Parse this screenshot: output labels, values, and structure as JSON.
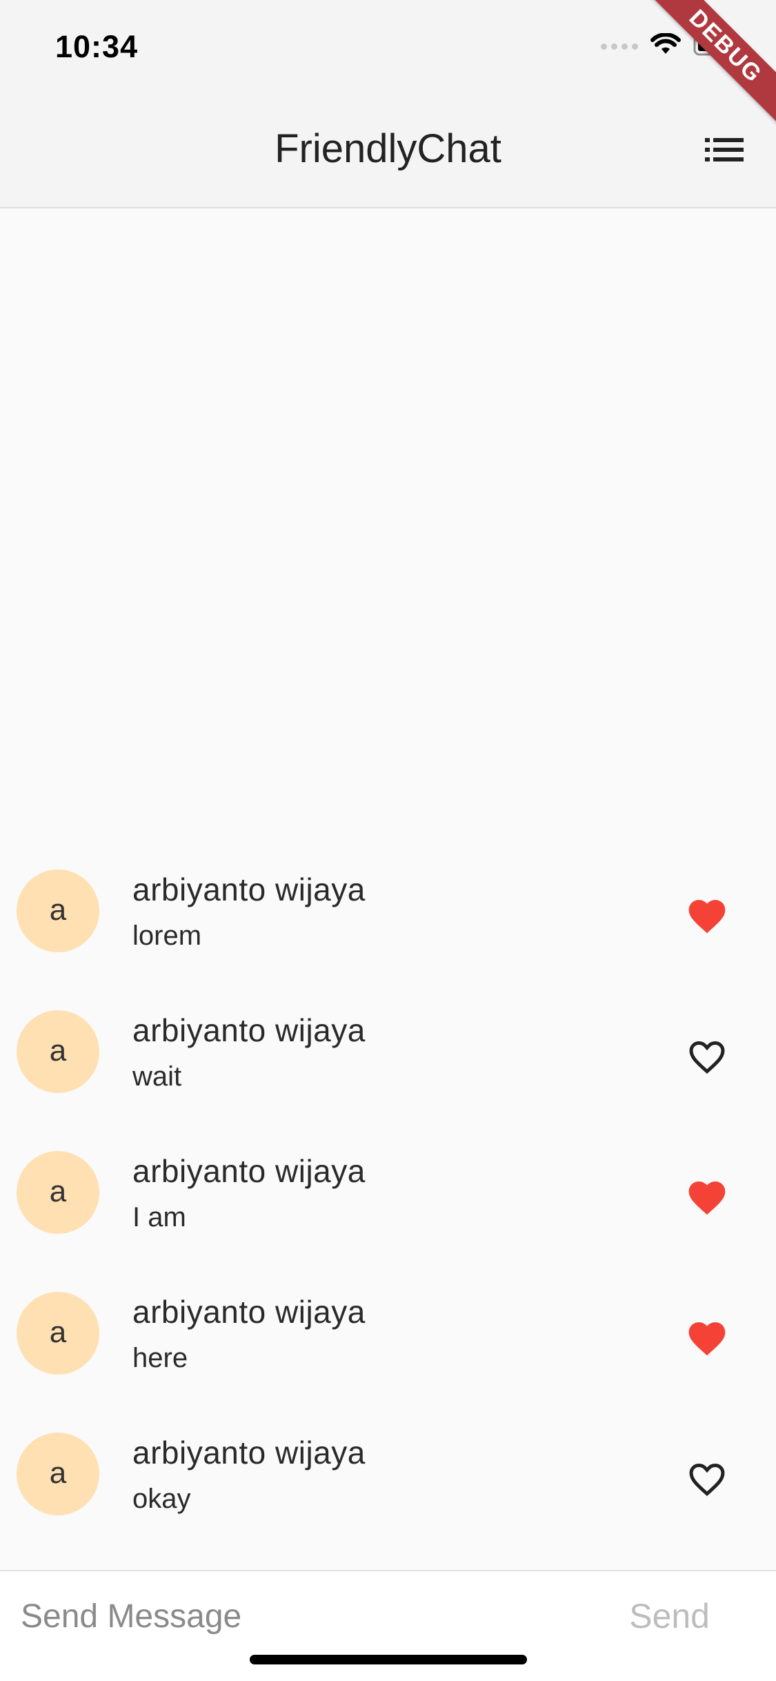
{
  "status_bar": {
    "time": "10:34",
    "icons": [
      "cellular-signal-icon",
      "wifi-icon",
      "battery-icon"
    ]
  },
  "debug_banner": "DEBUG",
  "app_bar": {
    "title": "FriendlyChat",
    "menu_icon": "list-icon"
  },
  "messages": [
    {
      "avatar": "a",
      "sender": "arbiyanto wijaya",
      "text": "lorem",
      "liked": true
    },
    {
      "avatar": "a",
      "sender": "arbiyanto wijaya",
      "text": "wait",
      "liked": false
    },
    {
      "avatar": "a",
      "sender": "arbiyanto wijaya",
      "text": "I am",
      "liked": true
    },
    {
      "avatar": "a",
      "sender": "arbiyanto wijaya",
      "text": "here",
      "liked": true
    },
    {
      "avatar": "a",
      "sender": "arbiyanto wijaya",
      "text": "okay",
      "liked": false
    }
  ],
  "composer": {
    "input_value": "",
    "placeholder": "Send Message",
    "send_label": "Send"
  },
  "colors": {
    "liked_heart": "#f44336",
    "unliked_heart": "#222222",
    "avatar_bg": "#ffe0b2",
    "debug_banner": "#b0393f"
  }
}
